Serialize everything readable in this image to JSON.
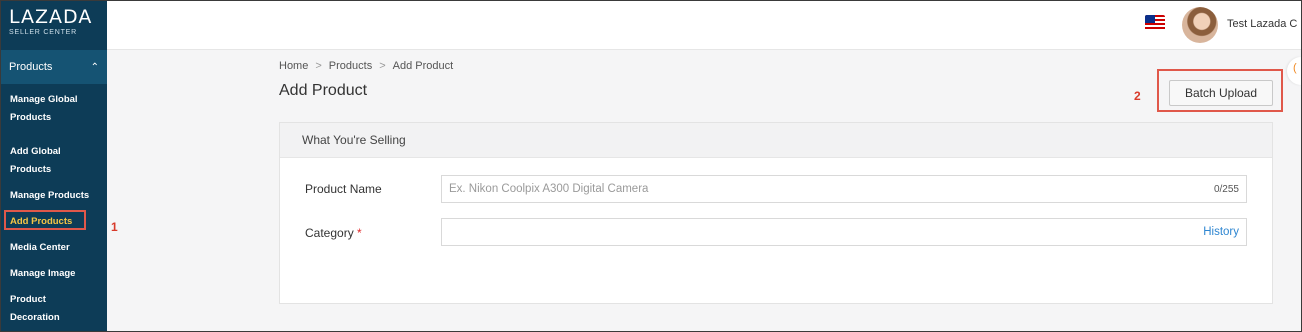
{
  "logo": {
    "main": "LAZADA",
    "sub": "SELLER CENTER"
  },
  "sidebar": {
    "section": "Products",
    "items": [
      {
        "label": "Manage Global Products",
        "lines": [
          "Manage Global",
          "Products"
        ]
      },
      {
        "label": "Add Global Products",
        "lines": [
          "Add Global",
          "Products"
        ]
      },
      {
        "label": "Manage Products",
        "lines": [
          "Manage Products"
        ]
      },
      {
        "label": "Add Products",
        "lines": [
          "Add Products"
        ]
      },
      {
        "label": "Media Center",
        "lines": [
          "Media Center"
        ]
      },
      {
        "label": "Manage Image",
        "lines": [
          "Manage Image"
        ]
      },
      {
        "label": "Product Decoration",
        "lines": [
          "Product",
          "Decoration"
        ]
      }
    ],
    "active_index": 3
  },
  "topbar": {
    "user_name": "Test Lazada C",
    "flag_icon": "malaysia-flag-icon"
  },
  "breadcrumb": [
    "Home",
    "Products",
    "Add Product"
  ],
  "page_title": "Add Product",
  "batch_upload_label": "Batch Upload",
  "steps": [
    "1",
    "2"
  ],
  "form": {
    "section_title": "What You're Selling",
    "product_name_label": "Product Name",
    "product_name_placeholder": "Ex. Nikon Coolpix A300 Digital Camera",
    "product_name_counter": "0/255",
    "category_label": "Category",
    "category_required": "*",
    "history_link": "History"
  },
  "colors": {
    "sidebar_bg": "#0d3c57",
    "active_item": "#f6c544",
    "highlight": "#e0584a",
    "link": "#2e86d1"
  }
}
